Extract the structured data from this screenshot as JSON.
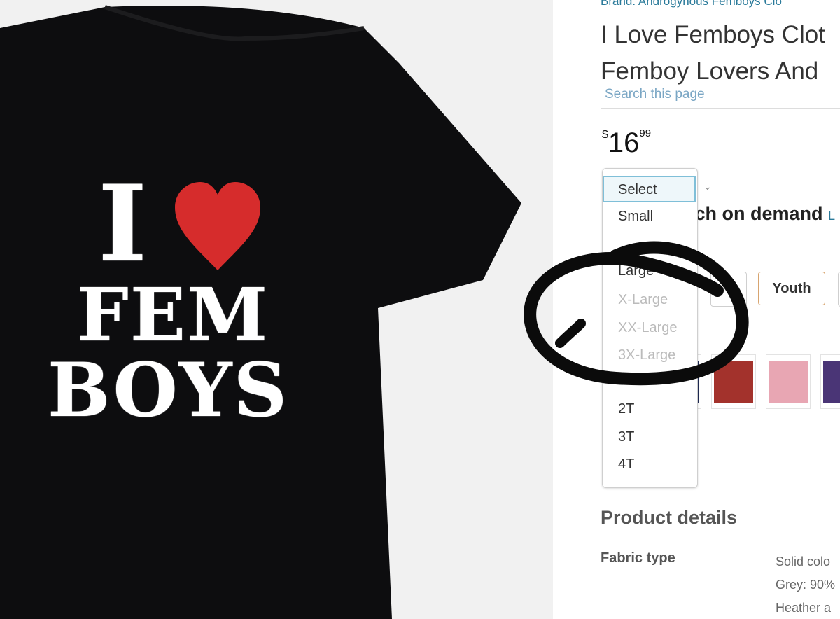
{
  "product_image": {
    "print_lines": [
      "I",
      "FEM",
      "BOYS"
    ]
  },
  "brand_line": "Brand: Androgynous Femboys Clo",
  "title_lines": [
    "I Love Femboys Clot",
    "Femboy Lovers And"
  ],
  "search_page_label": "Search this page",
  "price": {
    "symbol": "$",
    "whole": "16",
    "fraction": "99"
  },
  "size_select": {
    "current": "Select",
    "options": [
      {
        "label": "Small",
        "available": true
      },
      {
        "label": "Large",
        "available": true
      },
      {
        "label": "X-Large",
        "available": false
      },
      {
        "label": "XX-Large",
        "available": false
      },
      {
        "label": "3X-Large",
        "available": false
      },
      {
        "label": "2T",
        "available": true
      },
      {
        "label": "3T",
        "available": true
      },
      {
        "label": "4T",
        "available": true
      }
    ]
  },
  "demand_text": "rch on demand",
  "demand_link": "L",
  "fit_type": {
    "selected_label": "Youth"
  },
  "color_swatches": [
    "#1f2a55",
    "#a3322c",
    "#e8a6b3",
    "#4a3576"
  ],
  "product_details": {
    "heading": "Product details",
    "fabric_label": "Fabric type",
    "fabric_value_lines": [
      "Solid colo",
      "Grey: 90%",
      "Heather a"
    ]
  },
  "colors": {
    "shirt": "#0d0d0f",
    "heart": "#d62c2c",
    "link": "#2a7a9a"
  }
}
